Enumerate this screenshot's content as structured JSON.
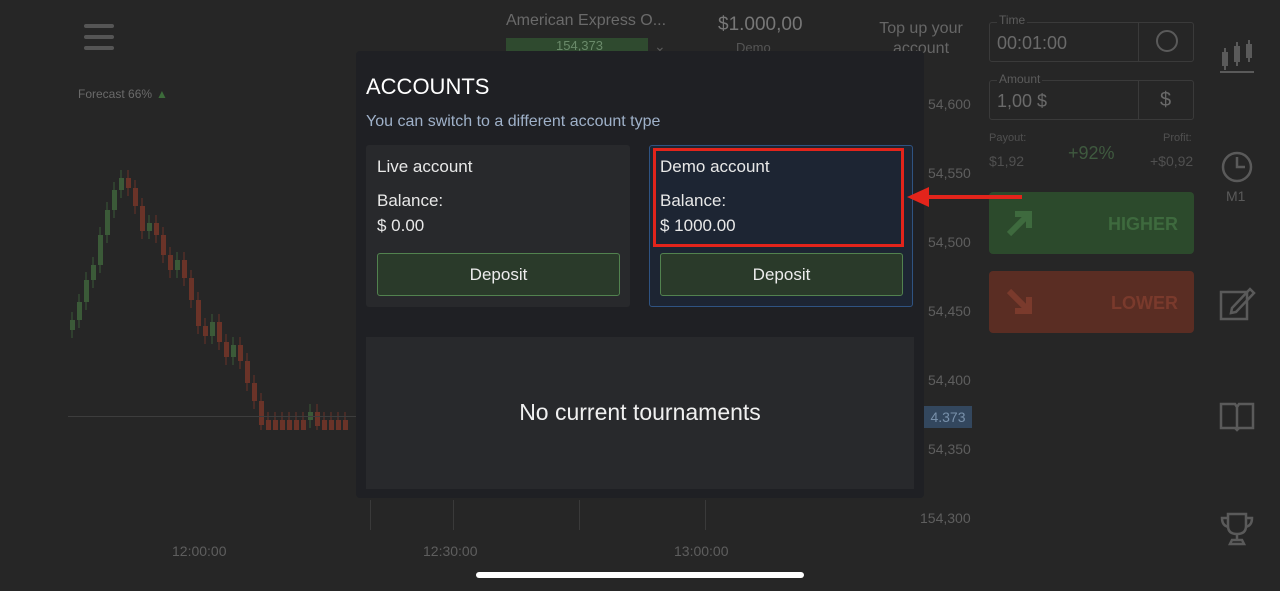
{
  "background": {
    "forecast_label": "Forecast 66%",
    "asset_name": "American Express O...",
    "asset_price": "154,373",
    "balance": "$1.000,00",
    "balance_mode": "Demo",
    "top_up": "Top up your account",
    "price_ticks": [
      "54,600",
      "54,550",
      "54,500",
      "54,450",
      "54,400",
      "54,350",
      "154,300"
    ],
    "current_price": "4.373",
    "time_ticks": [
      "12:00:00",
      "12:30:00",
      "13:00:00"
    ],
    "time": {
      "label": "Time",
      "value": "00:01:00"
    },
    "amount": {
      "label": "Amount",
      "value": "1,00 $",
      "currency_symbol": "$"
    },
    "payout": {
      "label": "Payout:",
      "value": "$1,92"
    },
    "profit": {
      "label": "Profit:",
      "value": "+$0,92"
    },
    "percent": "+92%",
    "higher_label": "HIGHER",
    "lower_label": "LOWER",
    "timeframe": "M1",
    "colors": {
      "higher": "#2c4a2c",
      "lower": "#5a2d23",
      "accent_blue": "#2f5382",
      "highlight_red": "#e3241b"
    }
  },
  "modal": {
    "title": "ACCOUNTS",
    "subtitle": "You can switch to a different account type",
    "live": {
      "title": "Live account",
      "balance_label": "Balance:",
      "balance": "$ 0.00",
      "deposit_label": "Deposit"
    },
    "demo": {
      "title": "Demo account",
      "balance_label": "Balance:",
      "balance": "$ 1000.00",
      "deposit_label": "Deposit"
    },
    "tournaments_text": "No current tournaments"
  }
}
